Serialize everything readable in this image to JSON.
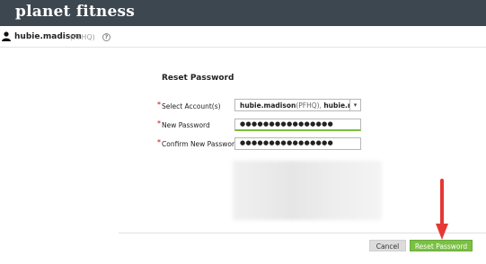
{
  "header": {
    "logo_text": "planet fitness"
  },
  "user": {
    "username": "hubie.madison",
    "org_code": "(PFHQ)",
    "help_glyph": "?"
  },
  "form": {
    "title": "Reset Password",
    "required_marker": "*",
    "select_label": "Select Account(s)",
    "select_value_user": "hubie.madison",
    "select_value_org": "(PFHQ),",
    "select_value_user2": "hubie.madiso",
    "new_password_label": "New Password",
    "new_password_value": "●●●●●●●●●●●●●●●●",
    "confirm_password_label": "Confirm New Password",
    "confirm_password_value": "●●●●●●●●●●●●●●●●"
  },
  "actions": {
    "cancel_label": "Cancel",
    "reset_label": "Reset Password"
  },
  "colors": {
    "topbar": "#3d4750",
    "accent_green": "#7ac143",
    "arrow_red": "#e53935"
  },
  "icons": {
    "user": "user-icon",
    "help": "help-icon",
    "dropdown": "chevron-down-icon"
  }
}
